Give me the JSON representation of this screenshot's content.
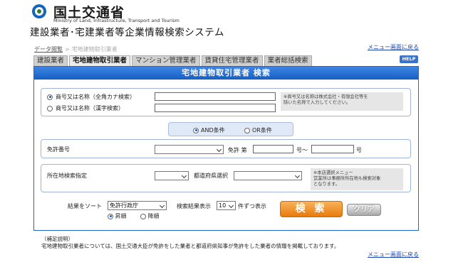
{
  "header": {
    "ministry_jp": "国土交通省",
    "ministry_en": "Ministry of Land, Infrastructure, Transport and Tourism",
    "system_title": "建設業者･宅建業者等企業情報検索システム"
  },
  "breadcrumb": {
    "link": "データ閲覧",
    "sep": ">",
    "current": "宅地建物取引業者"
  },
  "menu_link": "メニュー画面に戻る",
  "tabs": [
    "建設業者",
    "宅地建物取引業者",
    "マンション管理業者",
    "賃貸住宅管理業者",
    "業者総括検索"
  ],
  "help_label": "HELP",
  "panel_title": "宅地建物取引業者 検索",
  "name_search": {
    "option_kana": "商号又は名称（全角カナ検索）",
    "option_kanji": "商号又は名称（漢字検索）",
    "kana_value": "",
    "kanji_value": "",
    "note_line1": "※商号又は名称は株式会社・有限会社等を",
    "note_line2": "除いた名称で入力してください。"
  },
  "condition": {
    "and_label": "AND条件",
    "or_label": "OR条件"
  },
  "license": {
    "label": "免許番号",
    "select_value": "",
    "license_text": "免許 第",
    "from_value": "",
    "range_sep": "号～",
    "to_value": "",
    "suffix": "号"
  },
  "location": {
    "label": "所在地検索指定",
    "select_value": "",
    "pref_label": "都道府県選択",
    "pref_value": "",
    "note_line1": "※本店選択メニュー",
    "note_line2": "営業所は事務所所在地も検索対象",
    "note_line3": "となります。"
  },
  "sort": {
    "label": "結果をソート",
    "value": "免許行政庁",
    "asc": "昇順",
    "desc": "降順"
  },
  "display": {
    "label": "検索結果表示",
    "value": "10",
    "suffix": "件ずつ表示"
  },
  "buttons": {
    "search": "検 索",
    "clear": "クリア"
  },
  "footnote": {
    "title": "（補足説明）",
    "text": "宅地建物取引業者については、国土交通大臣が免許をした業者と都道府県知事が免許をした業者の情報を掲載しております。"
  }
}
